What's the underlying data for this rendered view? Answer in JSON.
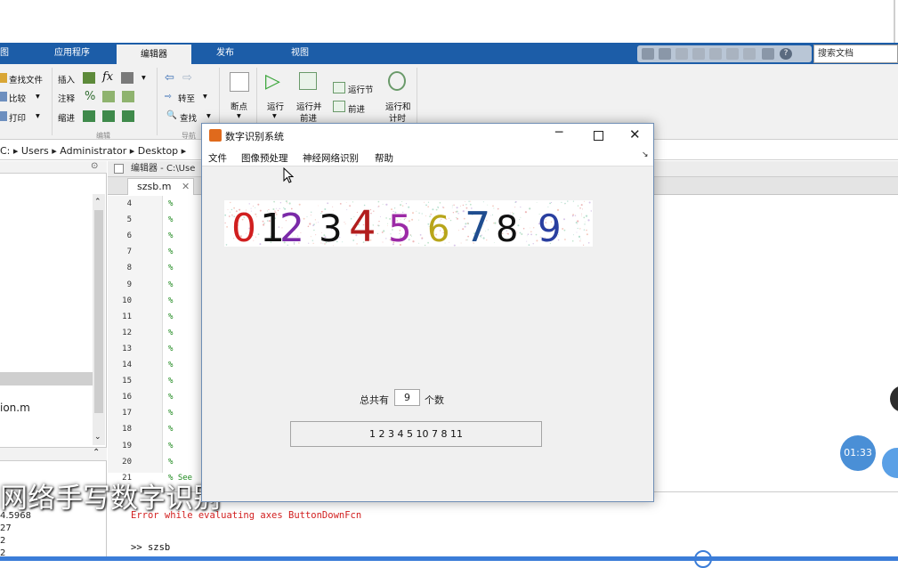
{
  "ribbon": {
    "tabs": [
      "图",
      "应用程序",
      "编辑器",
      "发布",
      "视图"
    ],
    "active_tab": "编辑器",
    "search_placeholder": "搜索文档",
    "file_group": [
      "查找文件",
      "比较",
      "打印"
    ],
    "edit_group": [
      "插入",
      "注释",
      "缩进"
    ],
    "edit_symbols": [
      "fx",
      "%"
    ],
    "nav_group": [
      "转至",
      "查找"
    ],
    "breakpoint_label": "断点",
    "run_label": "运行",
    "run_advance_label": [
      "运行并",
      "前进"
    ],
    "run_section_label": "运行节",
    "advance_label": "前进",
    "run_time_label": [
      "运行和",
      "计时"
    ],
    "section_labels": [
      "编辑",
      "导航"
    ]
  },
  "address": {
    "parts": [
      "C:",
      "Users",
      "Administrator",
      "Desktop"
    ]
  },
  "left_panel": {
    "file_item": "ion.m",
    "workspace_values": [
      "4.5968",
      "27",
      "2",
      "2"
    ]
  },
  "editor": {
    "header": "编辑器 - C:\\Use",
    "tab_label": "szsb.m",
    "line_numbers": [
      "4",
      "5",
      "6",
      "7",
      "8",
      "9",
      "10",
      "11",
      "12",
      "13",
      "14",
      "15",
      "16",
      "17",
      "18",
      "19",
      "20",
      "21"
    ],
    "line_marker": "%",
    "last_line_text": "% See"
  },
  "command": {
    "error_text": "Error while evaluating axes ButtonDownFcn",
    "prompt_text": ">> szsb"
  },
  "overlay": {
    "caption": "网络手写数字识别"
  },
  "dialog": {
    "title": "数字识别系统",
    "menus": [
      "文件",
      "图像预处理",
      "神经网络识别",
      "帮助"
    ],
    "count_prefix": "总共有",
    "count_value": "9",
    "count_suffix": "个数",
    "result": "1  2  3  4  5  10  7  8  11",
    "digits": [
      {
        "glyph": "0",
        "color": "#d01f1f"
      },
      {
        "glyph": "1",
        "color": "#111111"
      },
      {
        "glyph": "2",
        "color": "#7a2aa8"
      },
      {
        "glyph": "3",
        "color": "#111111"
      },
      {
        "glyph": "4",
        "color": "#b21e1e"
      },
      {
        "glyph": "5",
        "color": "#9c2aa6"
      },
      {
        "glyph": "6",
        "color": "#b8a51a"
      },
      {
        "glyph": "7",
        "color": "#1f4d8f"
      },
      {
        "glyph": "8",
        "color": "#111111"
      },
      {
        "glyph": "9",
        "color": "#2a3fa0"
      }
    ]
  },
  "player": {
    "time": "01:33"
  }
}
